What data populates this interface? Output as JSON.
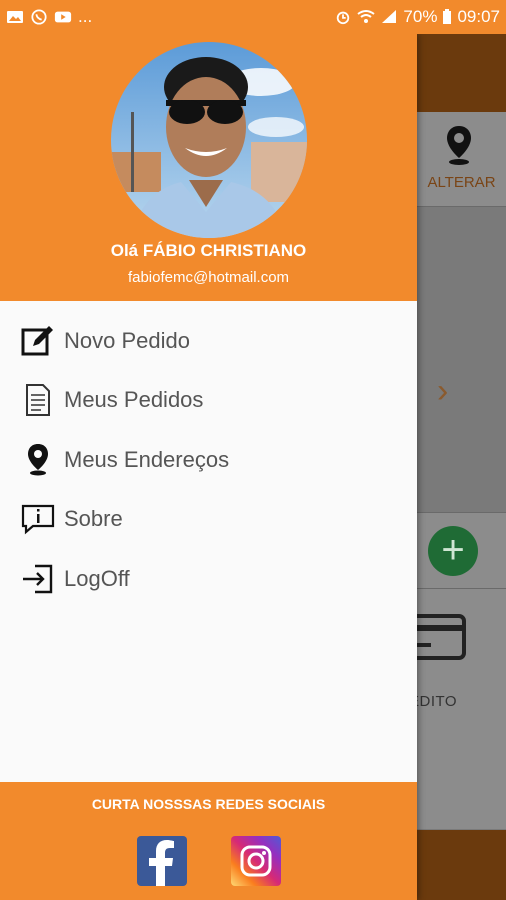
{
  "status_bar": {
    "left_icons": [
      "gallery-icon",
      "whatsapp-icon",
      "youtube-icon"
    ],
    "more": "...",
    "battery": "70%",
    "time": "09:07"
  },
  "drawer": {
    "header": {
      "greeting": "Olá FÁBIO CHRISTIANO",
      "email": "fabiofemc@hotmail.com"
    },
    "menu": [
      {
        "label": "Novo Pedido",
        "icon": "edit-icon"
      },
      {
        "label": "Meus Pedidos",
        "icon": "document-icon"
      },
      {
        "label": "Meus Endereços",
        "icon": "location-pin-icon"
      },
      {
        "label": "Sobre",
        "icon": "info-bubble-icon"
      },
      {
        "label": "LogOff",
        "icon": "logout-icon"
      }
    ],
    "footer": {
      "title": "CURTA NOSSSAS REDES SOCIAIS",
      "social": [
        "facebook-icon",
        "instagram-icon"
      ]
    }
  },
  "background_app": {
    "alterar_label": "ALTERAR",
    "card_label": "EDITO"
  },
  "colors": {
    "primary": "#f28a2c",
    "dark_brown": "#6b3a0d",
    "green_fab": "#1f6b35"
  }
}
